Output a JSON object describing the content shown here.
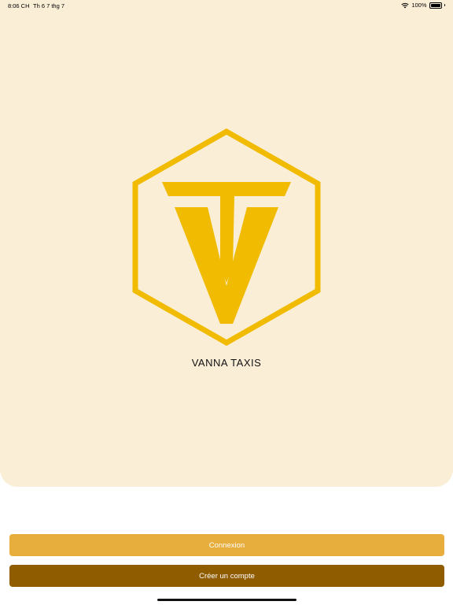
{
  "status_bar": {
    "time": "8:06 CH",
    "date": "Th 6 7 thg 7",
    "battery": "100%",
    "icons": [
      "wifi-icon",
      "battery-icon"
    ]
  },
  "brand": {
    "name": "VANNA TAXIS",
    "logo": "vanna-taxis-hexagon-tv-logo",
    "logo_color": "#f0bb00"
  },
  "colors": {
    "hero_background": "#faeed7",
    "login_button": "#e8ae3d",
    "signup_button": "#8f5c00"
  },
  "actions": {
    "login_label": "Connexion",
    "signup_label": "Créer un compte"
  }
}
